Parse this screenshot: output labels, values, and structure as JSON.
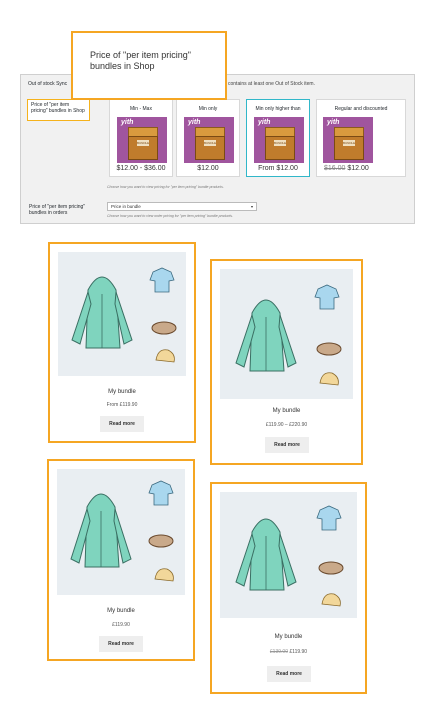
{
  "callout": {
    "title": "Price of \"per item pricing\" bundles in Shop"
  },
  "admin": {
    "out_of_stock_label": "Out of stock Sync",
    "out_of_stock_desc": "contains at least one Out of Stock item.",
    "shop_label": "Price of \"per item pricing\" bundles in Shop",
    "options": [
      {
        "title": "Min - Max",
        "brand": "yith",
        "price": "$12.00 - $36.00"
      },
      {
        "title": "Min only",
        "brand": "yith",
        "price": "$12.00"
      },
      {
        "title": "Min only higher than",
        "brand": "yith",
        "price": "From $12.00",
        "selected": true
      },
      {
        "title": "Regular and discounted",
        "brand": "yith",
        "price_old": "$16.00",
        "price": "$12.00"
      }
    ],
    "box_tag": "BUNDLE",
    "shop_help": "Choose how you want to view pricing for \"per item pricing\" bundle products.",
    "orders_label": "Price of \"per item pricing\" bundles in orders",
    "orders_select": "Price in bundle",
    "orders_help": "Choose how you want to view order pricing for \"per item pricing\" bundle products."
  },
  "cards": [
    {
      "name": "My bundle",
      "price": "From £119.90",
      "button": "Read more"
    },
    {
      "name": "My bundle",
      "price": "£119.90 – £220.90",
      "button": "Read more"
    },
    {
      "name": "My bundle",
      "price": "£119.90",
      "button": "Read more"
    },
    {
      "name": "My bundle",
      "price_old": "£139.00",
      "price": "£119.90",
      "button": "Read more"
    }
  ],
  "colors": {
    "accent_outline": "#f5a623",
    "selected_outline": "#31b7c9",
    "yith_purple": "#a0559e",
    "hoodie": "#7fd4be"
  },
  "icons": [
    "hoodie-icon",
    "polo-shirt-icon",
    "belt-icon",
    "cap-icon",
    "bundle-box-icon"
  ]
}
